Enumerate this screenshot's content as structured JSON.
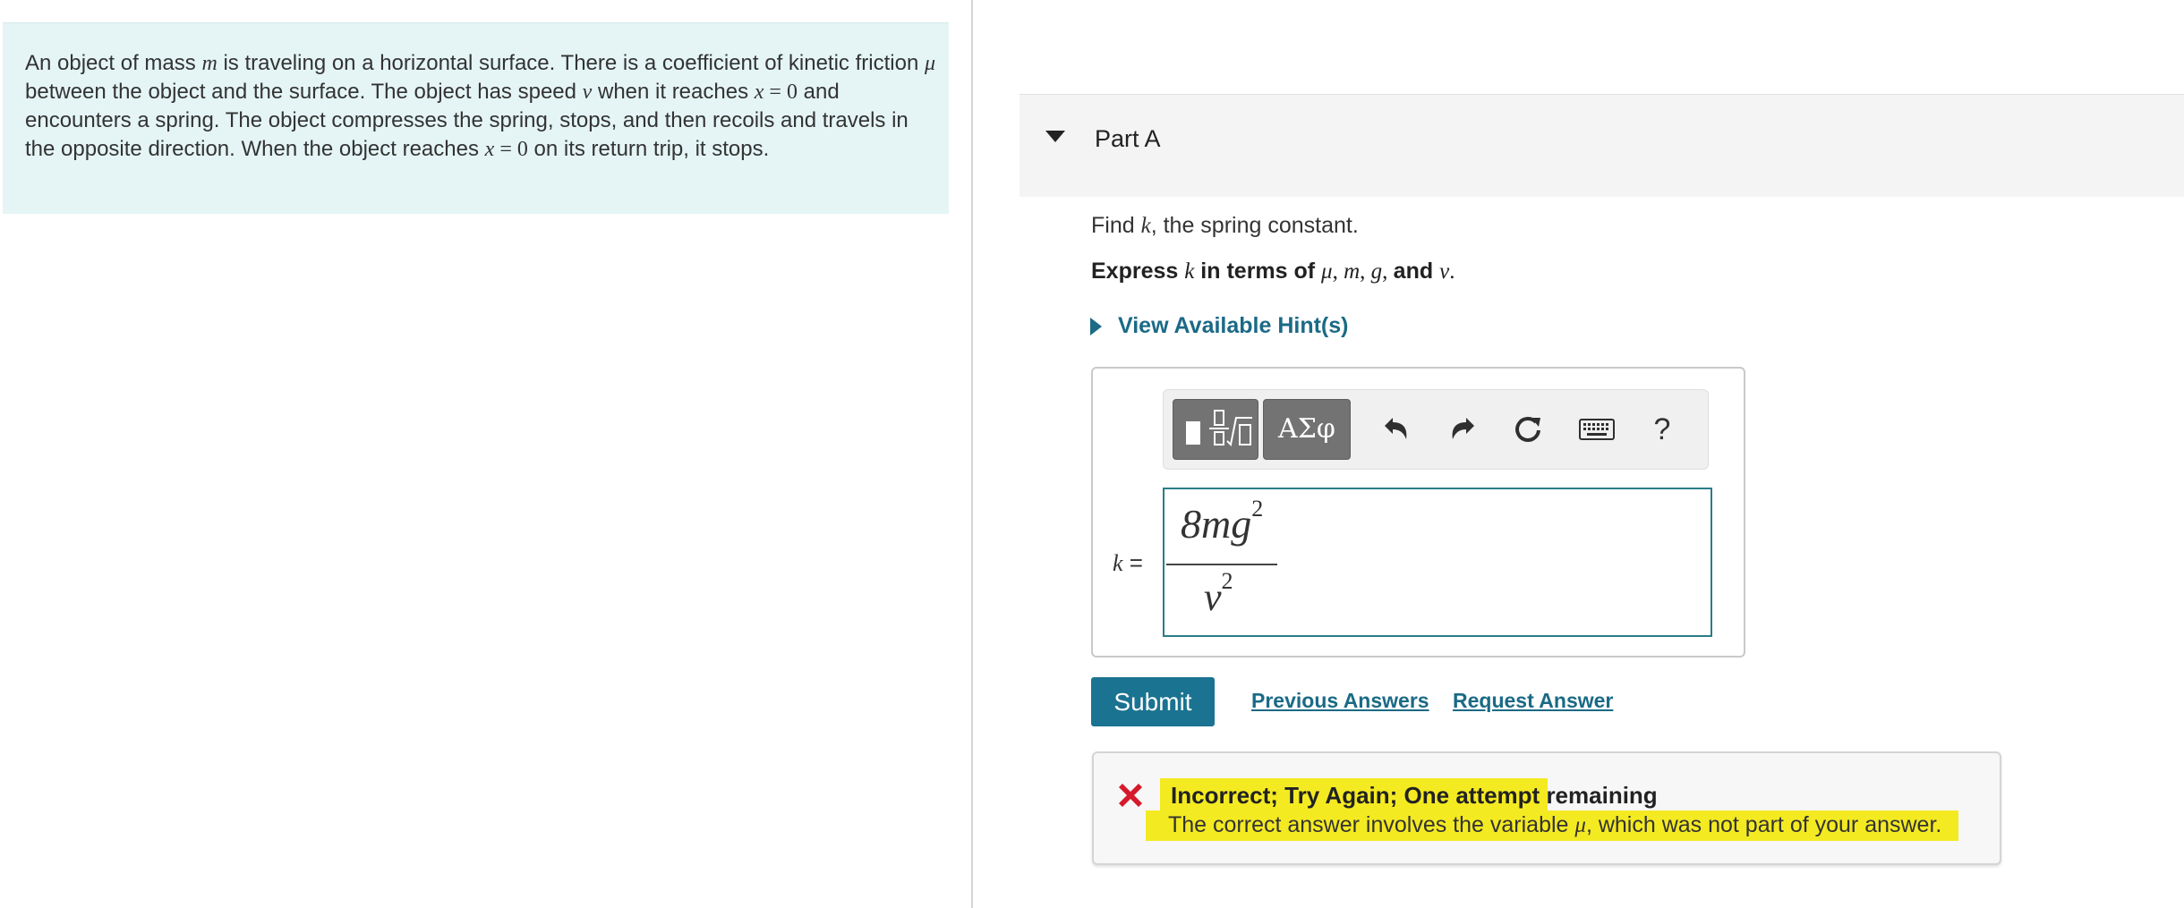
{
  "problem": {
    "t1": "An object of mass ",
    "m": "m",
    "t2": " is traveling on a horizontal surface. There is a coefficient of kinetic friction ",
    "mu": "μ",
    "t3": " between the object and the surface. The object has speed ",
    "v": "v",
    "t4": " when it reaches ",
    "x1": "x",
    "eq1": " = 0",
    "t5": " and encounters a spring. The object compresses the spring, stops, and then recoils and travels in the opposite direction. When the object reaches ",
    "x2": "x",
    "eq2": " = 0",
    "t6": " on its return trip, it stops."
  },
  "part": {
    "title": "Part A"
  },
  "question": {
    "find_pre": "Find ",
    "find_var": "k",
    "find_post": ", the spring constant.",
    "express_pre": "Express ",
    "express_var": "k",
    "express_mid": " in terms of ",
    "v1": "μ",
    "v2": "m",
    "v3": "g",
    "v4": "v",
    "sep": ", ",
    "and": "and ",
    "period": "."
  },
  "hints": {
    "label": "View Available Hint(s)"
  },
  "toolbar": {
    "greek_label": "ΑΣφ",
    "help_label": "?",
    "icons": [
      "templates-icon",
      "undo-icon",
      "redo-icon",
      "reset-icon",
      "keyboard-icon",
      "help-icon"
    ]
  },
  "answer": {
    "label": "k",
    "label_eq": " =",
    "numerator": "8mg",
    "numerator_exp": "2",
    "denominator": "v",
    "denominator_exp": "2"
  },
  "actions": {
    "submit": "Submit",
    "previous_answers": "Previous Answers",
    "request_answer": "Request Answer"
  },
  "feedback": {
    "title": "Incorrect; Try Again; One attempt remaining",
    "msg_pre": "The correct answer involves the variable ",
    "msg_var": "μ",
    "msg_post": ", which was not part of your answer.",
    "error_color": "#d6192b",
    "highlight_color": "#f4ea22"
  },
  "colors": {
    "accent": "#1a7391",
    "link": "#1a6a86",
    "panel": "#e5f5f6"
  }
}
